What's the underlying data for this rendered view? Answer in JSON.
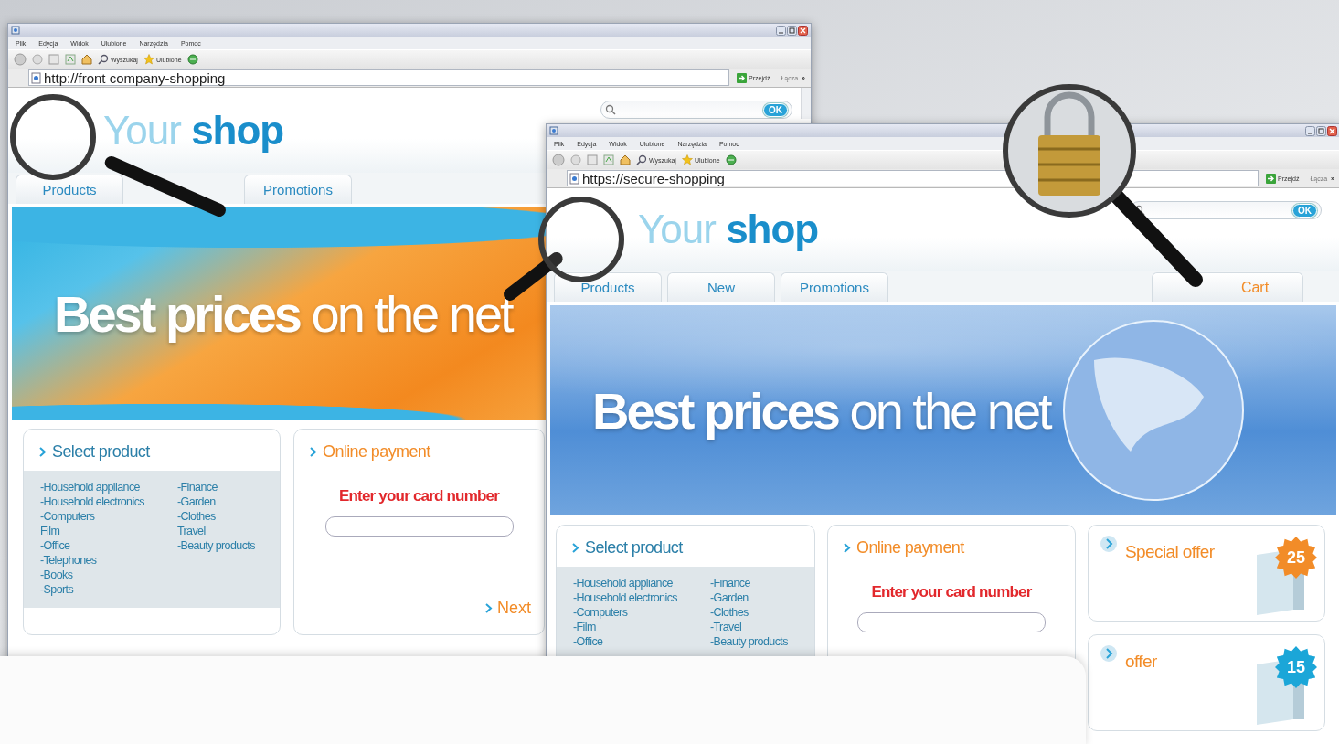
{
  "windows": [
    {
      "menu": [
        "Plik",
        "Edycja",
        "Widok",
        "Ulubione",
        "Narzędzia",
        "Pomoc"
      ],
      "toolbar": {
        "search": "Wyszukaj",
        "favorites": "Ulubione"
      },
      "address": "http://front company-shopping",
      "go": "Przejdź",
      "links": "Łącza",
      "links_more": "»",
      "search_button": "OK",
      "logo": {
        "light": "Your",
        "bold": "shop"
      },
      "tabs": [
        {
          "label": "Products"
        },
        {
          "label": "Promotions"
        }
      ],
      "banner": {
        "bold": "Best prices",
        "light": "on the net"
      },
      "product_card": {
        "title": "Select product",
        "columns": [
          [
            "-Household appliance",
            "-Household electronics",
            "-Computers",
            "Film",
            "-Office",
            "-Telephones",
            "-Books",
            "-Sports"
          ],
          [
            "-Finance",
            "-Garden",
            "-Clothes",
            "Travel",
            "-Beauty products"
          ]
        ]
      },
      "payment_card": {
        "title": "Online payment",
        "prompt": "Enter your card number",
        "next": "Next"
      }
    },
    {
      "menu": [
        "Plik",
        "Edycja",
        "Widok",
        "Ulubione",
        "Narzędzia",
        "Pomoc"
      ],
      "toolbar": {
        "search": "Wyszukaj",
        "favorites": "Ulubione"
      },
      "address": "https://secure-shopping",
      "go": "Przejdź",
      "links": "Łącza",
      "links_more": "»",
      "search_button": "OK",
      "logo": {
        "light": "Your",
        "bold": "shop"
      },
      "tabs": [
        {
          "label": "Products"
        },
        {
          "label": "New"
        },
        {
          "label": "Promotions"
        }
      ],
      "cart": "Cart",
      "banner": {
        "bold": "Best prices",
        "light": "on the net"
      },
      "product_card": {
        "title": "Select product",
        "columns": [
          [
            "-Household appliance",
            "-Household electronics",
            "-Computers",
            "-Film",
            "-Office"
          ],
          [
            "-Finance",
            "-Garden",
            "-Clothes",
            "-Travel",
            "-Beauty products"
          ]
        ]
      },
      "payment_card": {
        "title": "Online payment",
        "prompt": "Enter your card number"
      },
      "offers": [
        {
          "title": "Special offer",
          "badge": "25",
          "color": "#f28c28"
        },
        {
          "title": "offer",
          "badge": "15",
          "color": "#1ba6d8"
        }
      ]
    }
  ]
}
